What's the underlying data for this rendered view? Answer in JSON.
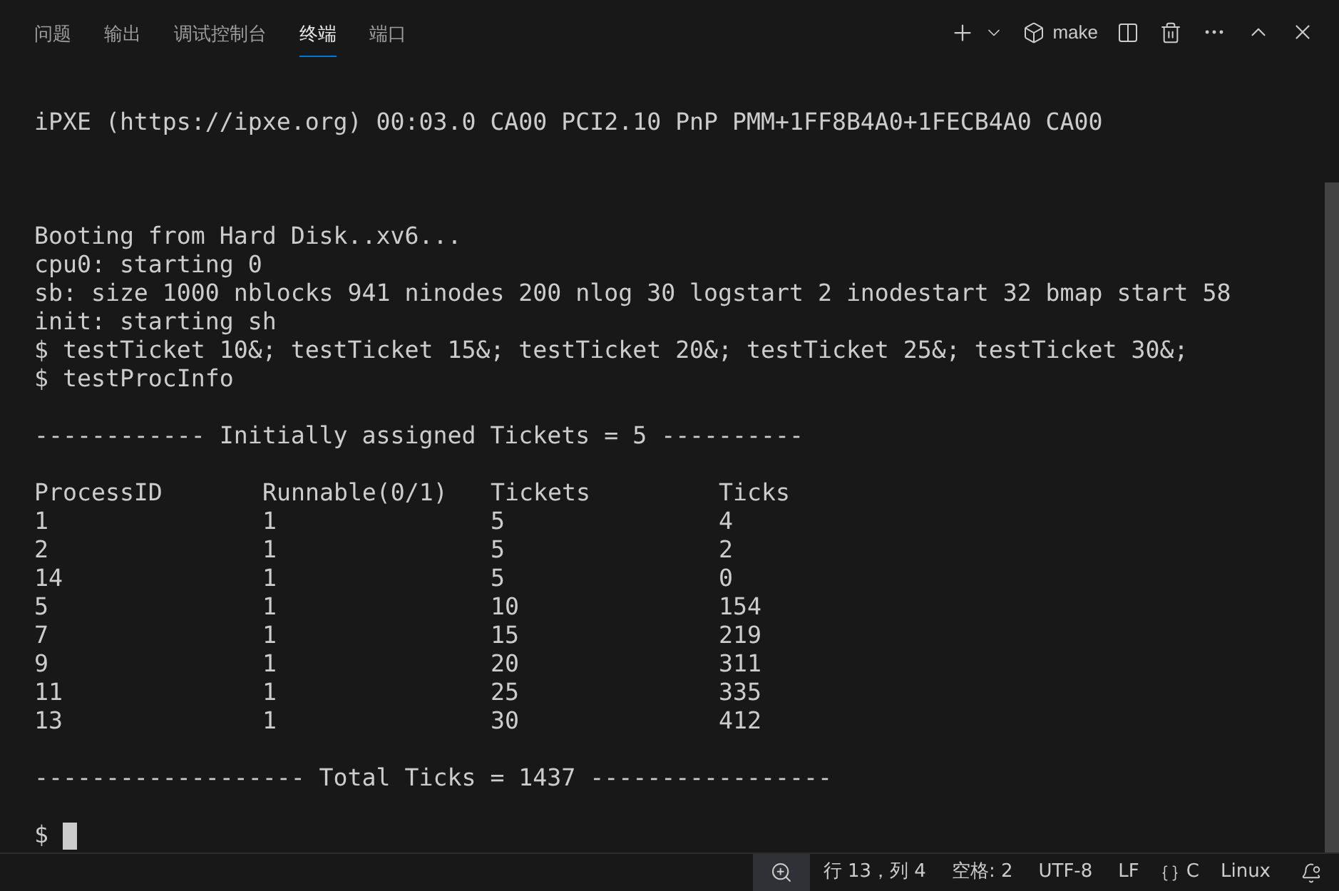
{
  "tabs": [
    {
      "label": "问题",
      "selected": false
    },
    {
      "label": "输出",
      "selected": false
    },
    {
      "label": "调试控制台",
      "selected": false
    },
    {
      "label": "终端",
      "selected": true
    },
    {
      "label": "端口",
      "selected": false
    }
  ],
  "terminal_profile": {
    "label": "make"
  },
  "terminal": {
    "lines": [
      {
        "kind": "text",
        "text": "iPXE (https://ipxe.org) 00:03.0 CA00 PCI2.10 PnP PMM+1FF8B4A0+1FECB4A0 CA00"
      },
      {
        "kind": "blank"
      },
      {
        "kind": "blank"
      },
      {
        "kind": "blank"
      },
      {
        "kind": "text",
        "text": "Booting from Hard Disk..xv6..."
      },
      {
        "kind": "text",
        "text": "cpu0: starting 0"
      },
      {
        "kind": "text",
        "text": "sb: size 1000 nblocks 941 ninodes 200 nlog 30 logstart 2 inodestart 32 bmap start 58"
      },
      {
        "kind": "text",
        "text": "init: starting sh"
      },
      {
        "kind": "text",
        "text": "$ testTicket 10&; testTicket 15&; testTicket 20&; testTicket 25&; testTicket 30&;"
      },
      {
        "kind": "text",
        "text": "$ testProcInfo"
      },
      {
        "kind": "blank"
      },
      {
        "kind": "text",
        "text": "------------ Initially assigned Tickets = 5 ----------"
      },
      {
        "kind": "blank"
      },
      {
        "kind": "row",
        "cells": [
          "ProcessID",
          "Runnable(0/1)",
          "Tickets",
          "Ticks"
        ]
      },
      {
        "kind": "row",
        "cells": [
          "1",
          "1",
          "5",
          "4"
        ]
      },
      {
        "kind": "row",
        "cells": [
          "2",
          "1",
          "5",
          "2"
        ]
      },
      {
        "kind": "row",
        "cells": [
          "14",
          "1",
          "5",
          "0"
        ]
      },
      {
        "kind": "row",
        "cells": [
          "5",
          "1",
          "10",
          "154"
        ]
      },
      {
        "kind": "row",
        "cells": [
          "7",
          "1",
          "15",
          "219"
        ]
      },
      {
        "kind": "row",
        "cells": [
          "9",
          "1",
          "20",
          "311"
        ]
      },
      {
        "kind": "row",
        "cells": [
          "11",
          "1",
          "25",
          "335"
        ]
      },
      {
        "kind": "row",
        "cells": [
          "13",
          "1",
          "30",
          "412"
        ]
      },
      {
        "kind": "blank"
      },
      {
        "kind": "text",
        "text": "------------------- Total Ticks = 1437 -----------------"
      },
      {
        "kind": "blank"
      },
      {
        "kind": "prompt",
        "text": "$"
      }
    ]
  },
  "status_bar": {
    "cursor_position": "行 13，列 4",
    "indentation": "空格: 2",
    "encoding": "UTF-8",
    "line_ending": "LF",
    "language": "C",
    "platform": "Linux"
  }
}
